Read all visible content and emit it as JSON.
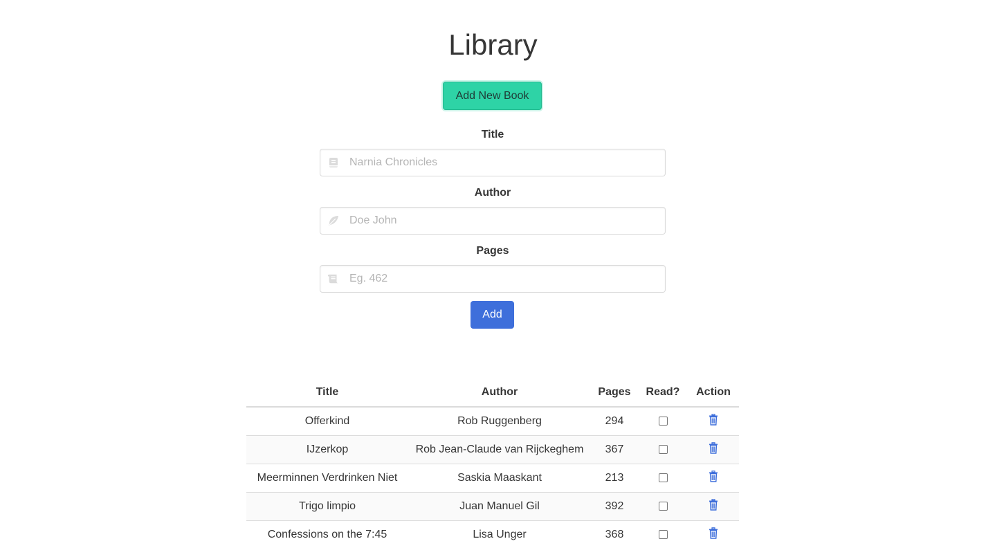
{
  "header": {
    "title": "Library"
  },
  "actions": {
    "add_new_label": "Add New Book",
    "submit_label": "Add"
  },
  "form": {
    "title": {
      "label": "Title",
      "placeholder": "Narnia Chronicles",
      "icon": "book-icon"
    },
    "author": {
      "label": "Author",
      "placeholder": "Doe John",
      "icon": "feather-icon"
    },
    "pages": {
      "label": "Pages",
      "placeholder": "Eg. 462",
      "icon": "scroll-icon"
    }
  },
  "table": {
    "headers": {
      "title": "Title",
      "author": "Author",
      "pages": "Pages",
      "read": "Read?",
      "action": "Action"
    },
    "rows": [
      {
        "title": "Offerkind",
        "author": "Rob Ruggenberg",
        "pages": "294",
        "read": false
      },
      {
        "title": "IJzerkop",
        "author": "Rob Jean-Claude van Rijckeghem",
        "pages": "367",
        "read": false
      },
      {
        "title": "Meerminnen Verdrinken Niet",
        "author": "Saskia Maaskant",
        "pages": "213",
        "read": false
      },
      {
        "title": "Trigo limpio",
        "author": "Juan Manuel Gil",
        "pages": "392",
        "read": false
      },
      {
        "title": "Confessions on the 7:45",
        "author": "Lisa Unger",
        "pages": "368",
        "read": false
      }
    ],
    "action_icon": "trash-icon"
  },
  "colors": {
    "primary": "#3e6fdb",
    "accent": "#2ed3a6",
    "text": "#363636",
    "placeholder": "#b5b5b5"
  }
}
